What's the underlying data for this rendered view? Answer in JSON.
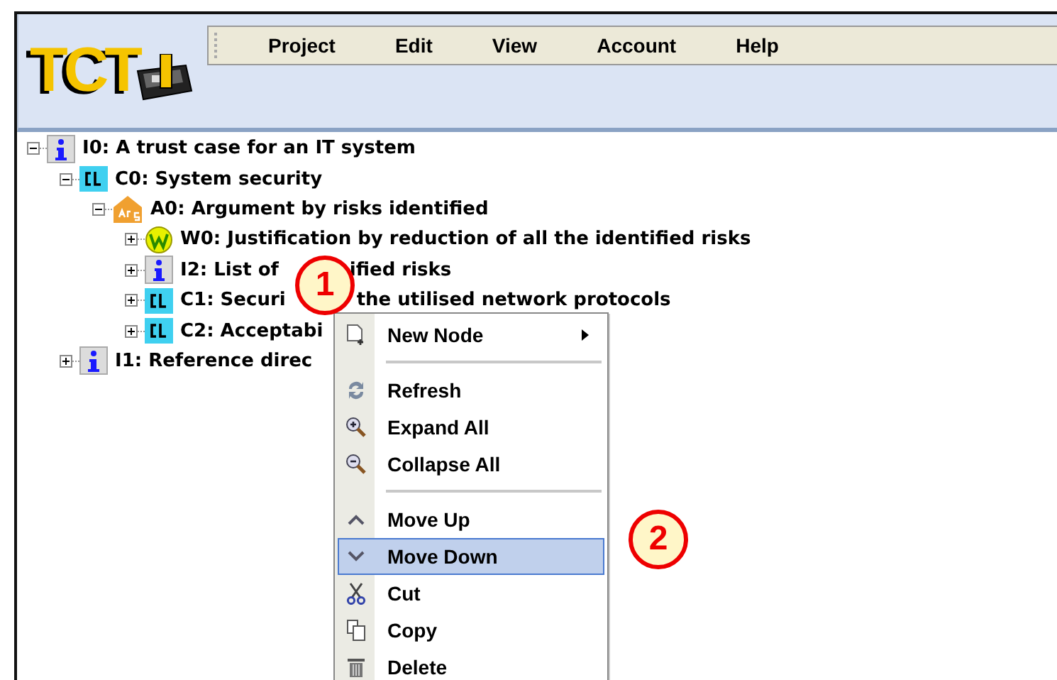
{
  "logo": {
    "text": "TCT"
  },
  "menubar": [
    "Project",
    "Edit",
    "View",
    "Account",
    "Help"
  ],
  "tree": [
    {
      "kind": "info",
      "label": "I0: A trust case for an IT system",
      "expanded": true,
      "children": [
        {
          "kind": "claim",
          "label": "C0: System security",
          "expanded": true,
          "children": [
            {
              "kind": "argument",
              "label": "A0: Argument by risks identified",
              "expanded": true,
              "children": [
                {
                  "kind": "warrant",
                  "label": "W0: Justification by reduction of all the identified risks",
                  "expanded": false
                },
                {
                  "kind": "info",
                  "label": "I2: List of",
                  "label_tail": "ified risks",
                  "expanded": false
                },
                {
                  "kind": "claim",
                  "label": "C1: Securi",
                  "label_tail": "the utilised network protocols",
                  "expanded": false
                },
                {
                  "kind": "claim",
                  "label": "C2: Acceptabi",
                  "expanded": false
                }
              ]
            }
          ]
        },
        {
          "kind": "info",
          "label": "I1: Reference direc",
          "expanded": false
        }
      ]
    }
  ],
  "context_menu": [
    {
      "kind": "item",
      "label": "New Node",
      "submenu": true,
      "selected": false
    },
    {
      "kind": "separator"
    },
    {
      "kind": "item",
      "label": "Refresh",
      "submenu": false,
      "selected": false
    },
    {
      "kind": "item",
      "label": "Expand All",
      "submenu": false,
      "selected": false
    },
    {
      "kind": "item",
      "label": "Collapse All",
      "submenu": false,
      "selected": false
    },
    {
      "kind": "separator"
    },
    {
      "kind": "item",
      "label": "Move Up",
      "submenu": false,
      "selected": false
    },
    {
      "kind": "item",
      "label": "Move Down",
      "submenu": false,
      "selected": true
    },
    {
      "kind": "item",
      "label": "Cut",
      "submenu": false,
      "selected": false
    },
    {
      "kind": "item",
      "label": "Copy",
      "submenu": false,
      "selected": false
    },
    {
      "kind": "item",
      "label": "Delete",
      "submenu": false,
      "selected": false
    }
  ],
  "callouts": [
    "1",
    "2"
  ]
}
